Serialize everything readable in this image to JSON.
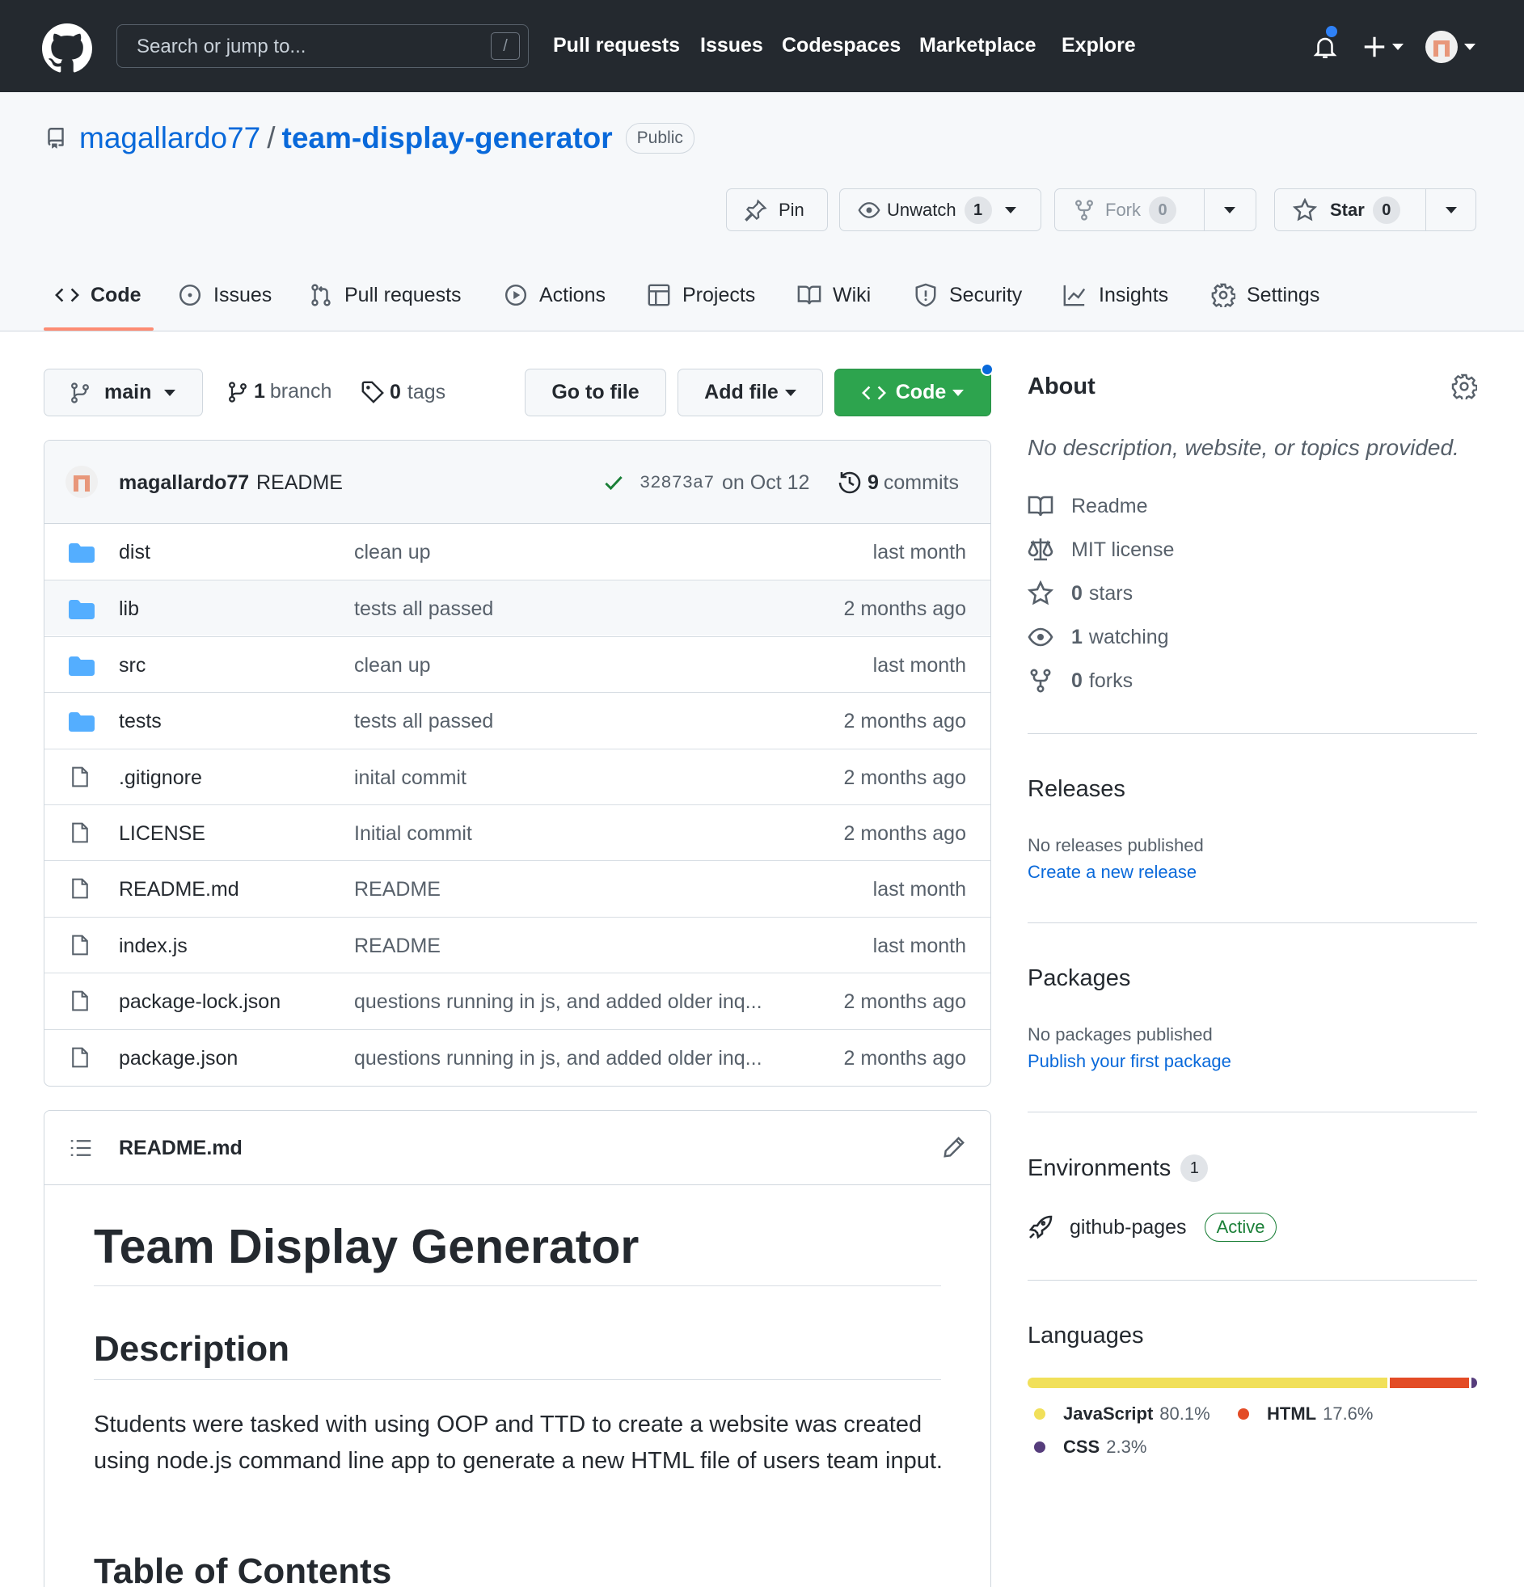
{
  "header": {
    "search_placeholder": "Search or jump to...",
    "search_shortcut": "/",
    "nav": [
      "Pull requests",
      "Issues",
      "Codespaces",
      "Marketplace",
      "Explore"
    ]
  },
  "repo": {
    "owner": "magallardo77",
    "separator": "/",
    "name": "team-display-generator",
    "visibility": "Public",
    "pin_label": "Pin",
    "unwatch_label": "Unwatch",
    "watch_count": "1",
    "fork_label": "Fork",
    "fork_count": "0",
    "star_label": "Star",
    "star_count": "0"
  },
  "tabs": [
    "Code",
    "Issues",
    "Pull requests",
    "Actions",
    "Projects",
    "Wiki",
    "Security",
    "Insights",
    "Settings"
  ],
  "toolbar": {
    "branch": "main",
    "branch_count": "1",
    "branch_word": "branch",
    "tag_count": "0",
    "tag_word": "tags",
    "go_to_file": "Go to file",
    "add_file": "Add file",
    "code": "Code"
  },
  "commit": {
    "author": "magallardo77",
    "message": "README",
    "sha": "32873a7",
    "date": "on Oct 12",
    "count": "9",
    "count_word": "commits"
  },
  "files": [
    {
      "type": "dir",
      "name": "dist",
      "message": "clean up",
      "age": "last month"
    },
    {
      "type": "dir",
      "name": "lib",
      "message": "tests all passed",
      "age": "2 months ago"
    },
    {
      "type": "dir",
      "name": "src",
      "message": "clean up",
      "age": "last month"
    },
    {
      "type": "dir",
      "name": "tests",
      "message": "tests all passed",
      "age": "2 months ago"
    },
    {
      "type": "file",
      "name": ".gitignore",
      "message": "inital commit",
      "age": "2 months ago"
    },
    {
      "type": "file",
      "name": "LICENSE",
      "message": "Initial commit",
      "age": "2 months ago"
    },
    {
      "type": "file",
      "name": "README.md",
      "message": "README",
      "age": "last month"
    },
    {
      "type": "file",
      "name": "index.js",
      "message": "README",
      "age": "last month"
    },
    {
      "type": "file",
      "name": "package-lock.json",
      "message": "questions running in js, and added older inq...",
      "age": "2 months ago"
    },
    {
      "type": "file",
      "name": "package.json",
      "message": "questions running in js, and added older inq...",
      "age": "2 months ago"
    }
  ],
  "readme": {
    "filename": "README.md",
    "h1": "Team Display Generator",
    "h2_description": "Description",
    "description_text": "Students were tasked with using OOP and TTD to create a website was created using node.js command line app to generate a new HTML file of users team input.",
    "h2_toc": "Table of Contents"
  },
  "about": {
    "title": "About",
    "description": "No description, website, or topics provided.",
    "readme": "Readme",
    "license": "MIT license",
    "stars_count": "0",
    "stars_word": "stars",
    "watching_count": "1",
    "watching_word": "watching",
    "forks_count": "0",
    "forks_word": "forks"
  },
  "releases": {
    "title": "Releases",
    "empty": "No releases published",
    "link": "Create a new release"
  },
  "packages": {
    "title": "Packages",
    "empty": "No packages published",
    "link": "Publish your first package"
  },
  "environments": {
    "title": "Environments",
    "count": "1",
    "name": "github-pages",
    "status": "Active"
  },
  "languages": {
    "title": "Languages",
    "items": [
      {
        "name": "JavaScript",
        "percent": "80.1%",
        "value": 80.1,
        "color": "#f1e05a"
      },
      {
        "name": "HTML",
        "percent": "17.6%",
        "value": 17.6,
        "color": "#e34c26"
      },
      {
        "name": "CSS",
        "percent": "2.3%",
        "value": 2.3,
        "color": "#563d7c"
      }
    ]
  },
  "colors": {
    "accent": "#0969da",
    "primary_button": "#2da44e",
    "header_bg": "#24292f",
    "tab_underline": "#fd8c73"
  }
}
